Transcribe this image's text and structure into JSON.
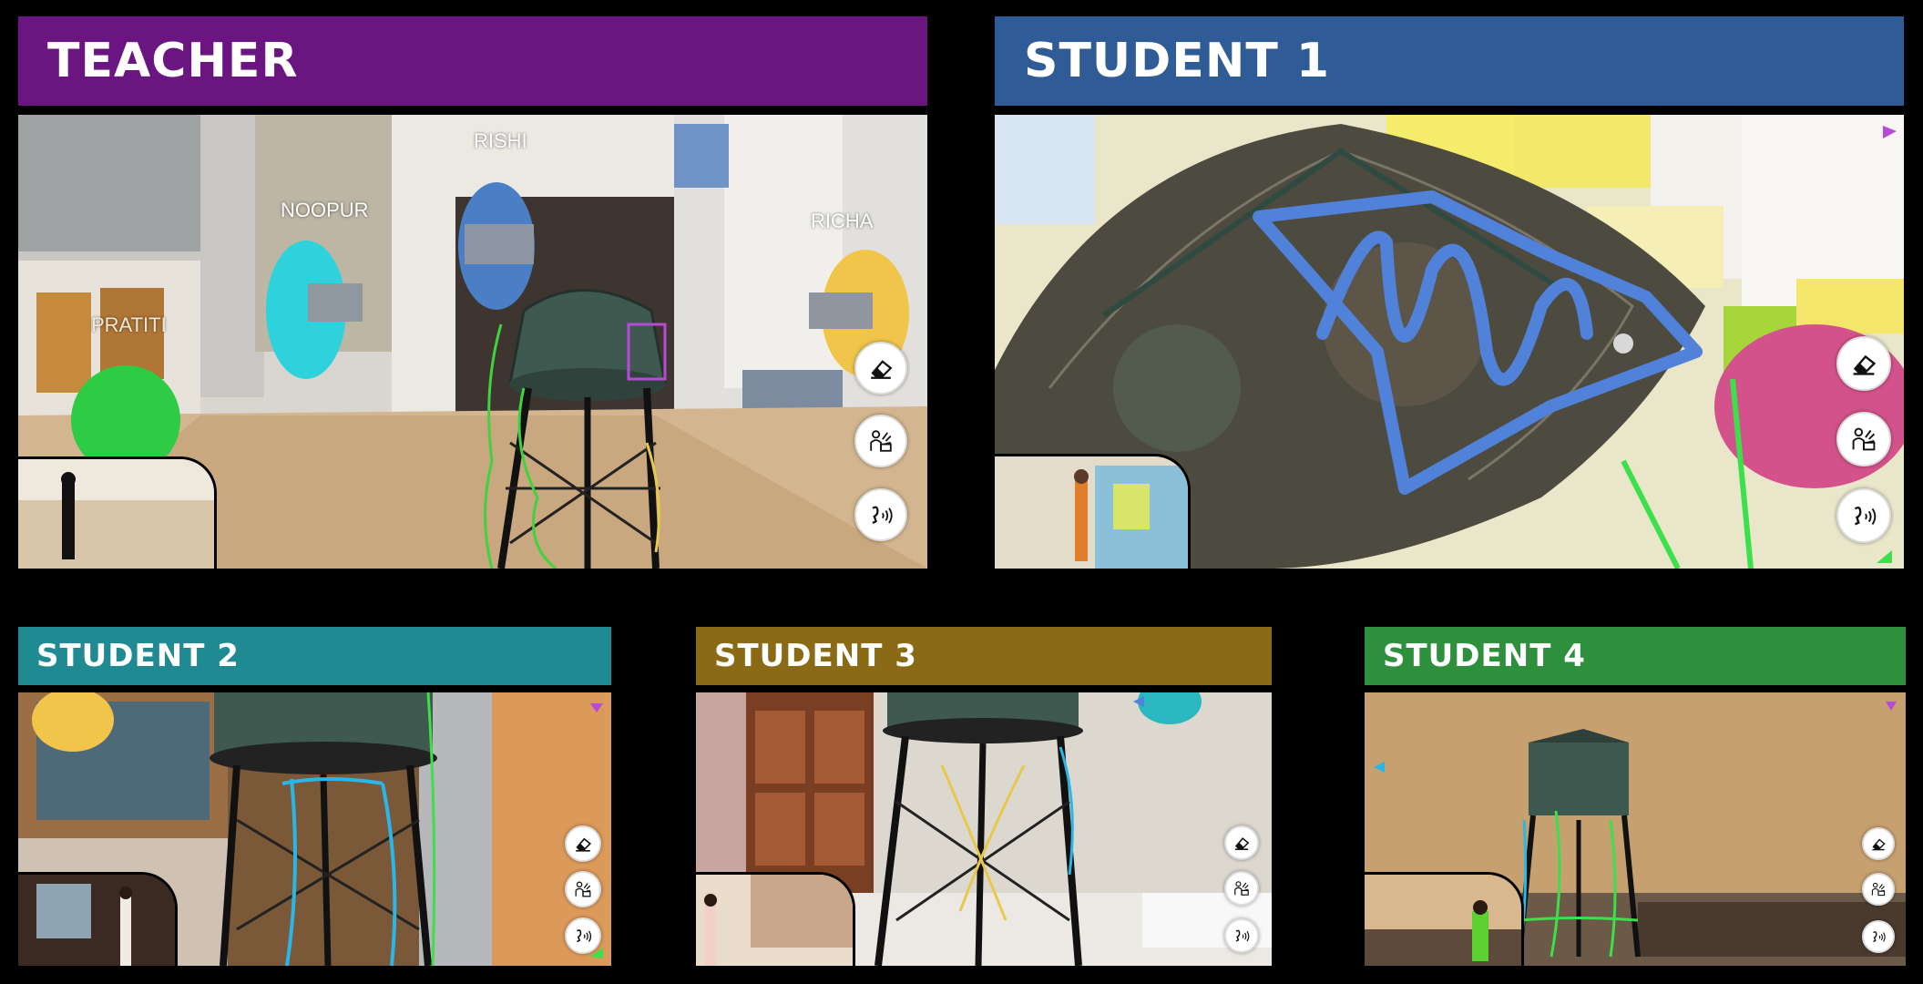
{
  "panels": {
    "teacher": {
      "title": "TEACHER",
      "header_color": "#6a1580",
      "avatars": [
        "RISHI",
        "NOOPUR",
        "RICHA",
        "PRATITI"
      ]
    },
    "student1": {
      "title": "STUDENT 1",
      "header_color": "#2f5c96"
    },
    "student2": {
      "title": "STUDENT 2",
      "header_color": "#1f8a92"
    },
    "student3": {
      "title": "STUDENT 3",
      "header_color": "#8a6a14"
    },
    "student4": {
      "title": "STUDENT 4",
      "header_color": "#2e8f3c"
    }
  },
  "toolbar": {
    "icons": [
      "eraser-icon",
      "gesture-icon",
      "voice-icon"
    ]
  }
}
